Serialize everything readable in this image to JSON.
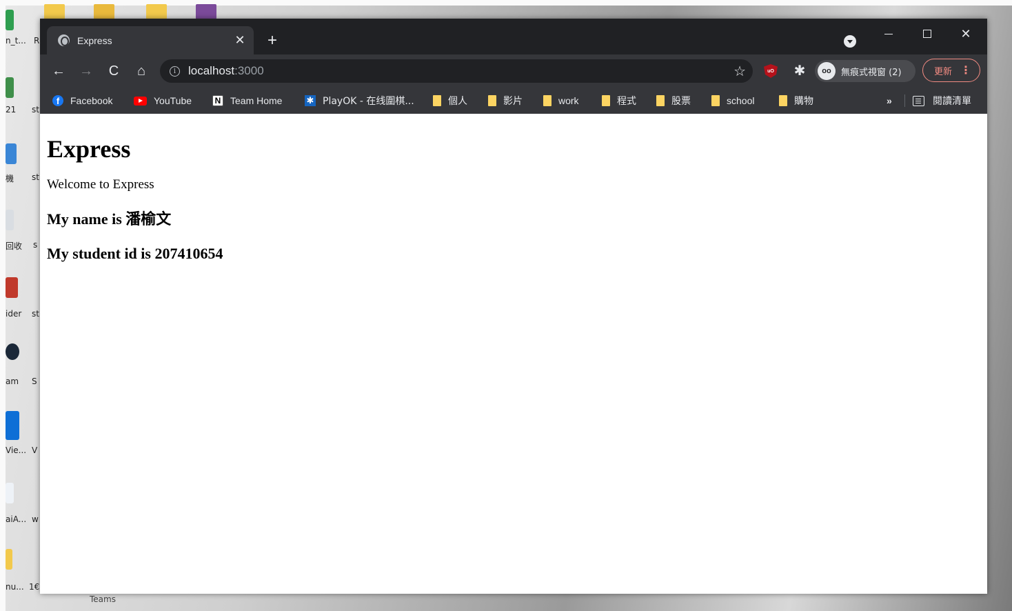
{
  "desktop": {
    "labels": [
      "n_t...",
      "R",
      "21",
      "st",
      "機",
      "st",
      "回收",
      "s",
      "ider",
      "st",
      "am",
      "S",
      "Vie...",
      "V",
      "aiA...",
      "w",
      "nu...",
      "1€",
      "Teams"
    ]
  },
  "browser": {
    "tab": {
      "title": "Express",
      "close": "✕"
    },
    "new_tab": "+",
    "window_controls": {
      "close": "✕"
    },
    "toolbar": {
      "back": "←",
      "forward": "→",
      "reload": "C",
      "home": "⌂",
      "info": "i",
      "url_host": "localhost",
      "url_port": ":3000",
      "star": "☆",
      "incognito_label": "無痕式視窗 (2)",
      "update_label": "更新",
      "menu": "⋮"
    },
    "bookmarks": [
      {
        "label": "Facebook",
        "icon": "facebook-icon"
      },
      {
        "label": "YouTube",
        "icon": "youtube-icon"
      },
      {
        "label": "Team Home",
        "icon": "notion-icon"
      },
      {
        "label": "PlayOK - 在线圍棋...",
        "icon": "playok-icon"
      },
      {
        "label": "個人",
        "icon": "folder-icon"
      },
      {
        "label": "影片",
        "icon": "folder-icon"
      },
      {
        "label": "work",
        "icon": "folder-icon"
      },
      {
        "label": "程式",
        "icon": "folder-icon"
      },
      {
        "label": "股票",
        "icon": "folder-icon"
      },
      {
        "label": "school",
        "icon": "folder-icon"
      },
      {
        "label": "購物",
        "icon": "folder-icon"
      }
    ],
    "bookmarks_more": "»",
    "reading_list": "閱讀清單"
  },
  "page": {
    "heading": "Express",
    "welcome": "Welcome to Express",
    "name_line": "My name is 潘榆文",
    "id_line": "My student id is 207410654"
  }
}
